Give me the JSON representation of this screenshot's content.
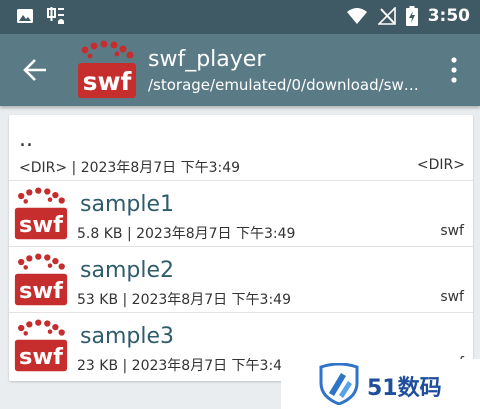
{
  "status_bar": {
    "time": "3:50",
    "left_icons": [
      "image-icon",
      "app-notification-icon"
    ],
    "right_icons": [
      "wifi-icon",
      "no-signal-icon",
      "battery-charging-icon"
    ]
  },
  "app_bar": {
    "title": "swf_player",
    "subtitle": "/storage/emulated/0/download/swf…",
    "logo_text": "swf",
    "accent": "#c62d2d"
  },
  "list": {
    "parent": {
      "name": "..",
      "meta": "<DIR> | 2023年8月7日 下午3:49",
      "type": "<DIR>"
    },
    "files": [
      {
        "name": "sample1",
        "meta": "5.8 KB | 2023年8月7日 下午3:49",
        "type": "swf",
        "icon_text": "swf"
      },
      {
        "name": "sample2",
        "meta": "53 KB | 2023年8月7日 下午3:49",
        "type": "swf",
        "icon_text": "swf"
      },
      {
        "name": "sample3",
        "meta": "23 KB | 2023年8月7日 下午3:49",
        "type": "swf",
        "icon_text": "swf"
      }
    ]
  },
  "watermark": {
    "text": "51数码"
  }
}
